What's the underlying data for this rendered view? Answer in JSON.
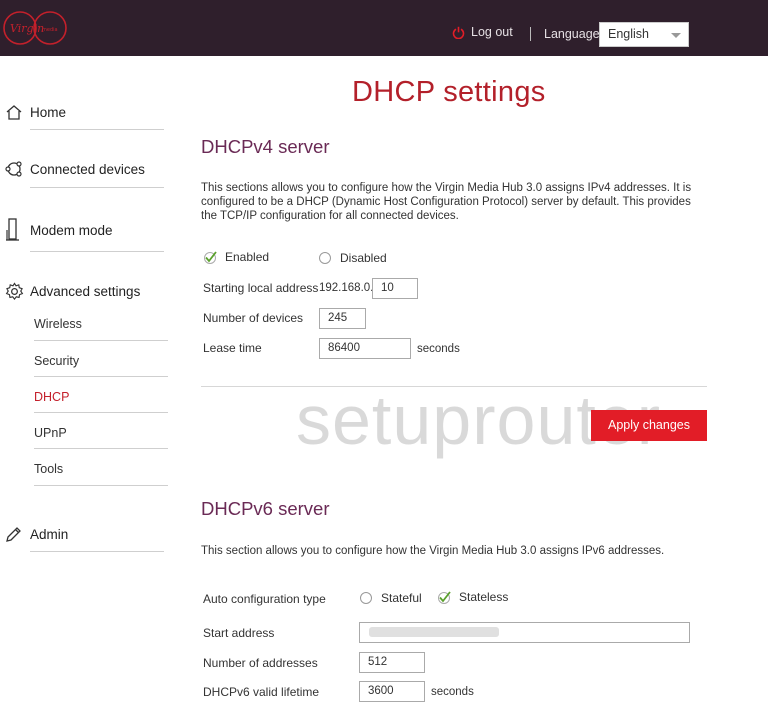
{
  "header": {
    "brand": "Virgin media",
    "logout_label": "Log out",
    "language_label": "Language",
    "language_selected": "English"
  },
  "sidebar": {
    "items": [
      {
        "label": "Home",
        "icon": "home-icon"
      },
      {
        "label": "Connected devices",
        "icon": "devices-icon"
      },
      {
        "label": "Modem mode",
        "icon": "modem-icon"
      },
      {
        "label": "Advanced settings",
        "icon": "gear-icon"
      },
      {
        "label": "Admin",
        "icon": "pencil-icon"
      }
    ],
    "sub_items": [
      {
        "label": "Wireless"
      },
      {
        "label": "Security"
      },
      {
        "label": "DHCP",
        "active": true
      },
      {
        "label": "UPnP"
      },
      {
        "label": "Tools"
      }
    ]
  },
  "page": {
    "title": "DHCP settings",
    "watermark": "setuprouter"
  },
  "dhcpv4": {
    "title": "DHCPv4 server",
    "description": "This sections allows you to configure how the Virgin Media Hub 3.0 assigns IPv4 addresses. It is configured to be a DHCP (Dynamic Host Configuration Protocol) server by default. This provides the TCP/IP configuration for all connected devices.",
    "enabled_label": "Enabled",
    "disabled_label": "Disabled",
    "enabled_selected": true,
    "start_label": "Starting local address",
    "start_prefix": "192.168.0.",
    "start_value": "10",
    "devices_label": "Number of devices",
    "devices_value": "245",
    "lease_label": "Lease time",
    "lease_value": "86400",
    "lease_unit": "seconds",
    "apply_label": "Apply changes"
  },
  "dhcpv6": {
    "title": "DHCPv6 server",
    "description": "This section allows you to configure how the Virgin Media Hub 3.0 assigns IPv6 addresses.",
    "auto_config_label": "Auto configuration type",
    "stateful_label": "Stateful",
    "stateless_label": "Stateless",
    "stateless_selected": true,
    "start_address_label": "Start address",
    "start_address_value": "",
    "num_addresses_label": "Number of addresses",
    "num_addresses_value": "512",
    "lifetime_label": "DHCPv6 valid lifetime",
    "lifetime_value": "3600",
    "lifetime_unit": "seconds"
  },
  "colors": {
    "header_bg": "#2f1f2c",
    "brand_red": "#c4202b",
    "title_red": "#b3202a",
    "section_purple": "#6a2a55",
    "button_red": "#e21d27",
    "check_green": "#5aa02c"
  }
}
